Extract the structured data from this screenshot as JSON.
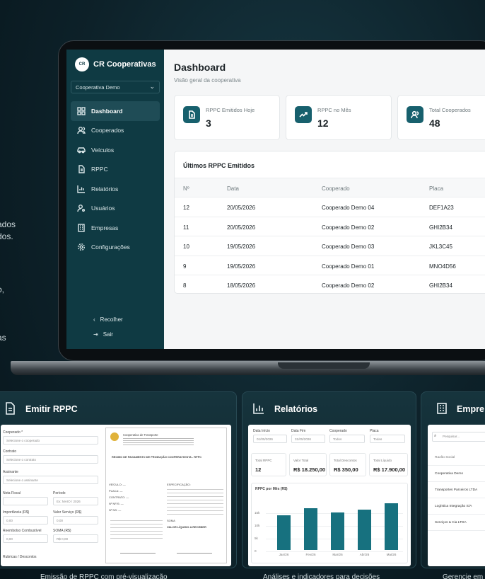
{
  "left_text": [
    "ados",
    "dos.",
    "o,",
    "as"
  ],
  "app": {
    "brand": "CR Cooperativas",
    "logo_text": "CR",
    "coop_select": "Cooperativa Demo"
  },
  "sidebar": {
    "items": [
      {
        "label": "Dashboard",
        "icon": "dashboard-icon",
        "active": true
      },
      {
        "label": "Cooperados",
        "icon": "users-icon"
      },
      {
        "label": "Veículos",
        "icon": "car-icon"
      },
      {
        "label": "RPPC",
        "icon": "document-icon"
      },
      {
        "label": "Relatórios",
        "icon": "chart-icon"
      },
      {
        "label": "Usuários",
        "icon": "user-key-icon"
      },
      {
        "label": "Empresas",
        "icon": "building-icon"
      },
      {
        "label": "Configurações",
        "icon": "gear-icon"
      }
    ],
    "collapse": "Recolher",
    "logout": "Sair"
  },
  "dashboard": {
    "title": "Dashboard",
    "subtitle": "Visão geral da cooperativa",
    "cards": [
      {
        "label": "RPPC Emitidos Hoje",
        "value": "3"
      },
      {
        "label": "RPPC no Mês",
        "value": "12"
      },
      {
        "label": "Total Cooperados",
        "value": "48"
      }
    ],
    "table": {
      "title": "Últimos RPPC Emitidos",
      "headers": [
        "Nº",
        "Data",
        "Cooperado",
        "Placa"
      ],
      "rows": [
        [
          "12",
          "20/05/2026",
          "Cooperado Demo 04",
          "DEF1A23"
        ],
        [
          "11",
          "20/05/2026",
          "Cooperado Demo 02",
          "GHI2B34"
        ],
        [
          "10",
          "19/05/2026",
          "Cooperado Demo 03",
          "JKL3C45"
        ],
        [
          "9",
          "19/05/2026",
          "Cooperado Demo 01",
          "MNO4D56"
        ],
        [
          "8",
          "18/05/2026",
          "Cooperado Demo 02",
          "GHI2B34"
        ]
      ]
    }
  },
  "panels": {
    "emitir": {
      "title": "Emitir RPPC",
      "caption": "Emissão de RPPC com pré-visualização",
      "form": {
        "cooperado_label": "Cooperado *",
        "cooperado_ph": "Selecione o cooperado",
        "contrato_label": "Contrato",
        "contrato_ph": "Selecione o contrato",
        "assinante_label": "Assinante",
        "assinante_ph": "Selecione o assinante",
        "nf_label": "Nota Fiscal",
        "periodo_label": "Período",
        "periodo_ph": "Ex: MAIO / 2026",
        "imp_label": "Importância (R$)",
        "imp_val": "0,00",
        "vs_label": "Valor Serviço (R$)",
        "vs_val": "0,00",
        "reemb_label": "Reembolso Combustível",
        "reemb_val": "0,00",
        "soma_label": "SOMA (R$)",
        "soma_val": "R$ 0,00",
        "rubricas": "Rubricas / Descontos"
      },
      "preview": {
        "header": "Cooperativa de Transporte",
        "title": "RECIBO DE PAGAMENTO DE PRODUÇÃO COOPERATIVISTA - RPPC",
        "veiculo": "VEÍCULO: —",
        "placa": "PLACA: —",
        "contrato": "CONTRATO: —",
        "nf": "Nº NF/S: —",
        "nota": "Nº NS: —",
        "espec": "ESPECIFICAÇÃO:",
        "soma": "SOMA",
        "liquido": "VALOR LÍQUIDO A RECEBER"
      }
    },
    "relatorios": {
      "title": "Relatórios",
      "caption": "Análises e indicadores para decisões",
      "filters": [
        {
          "label": "Data Início",
          "value": "01/05/2026"
        },
        {
          "label": "Data Fim",
          "value": "31/05/2026"
        },
        {
          "label": "Cooperado",
          "value": "Todos"
        },
        {
          "label": "Placa",
          "value": "Todas"
        }
      ],
      "kpis": [
        {
          "label": "Total RPPC",
          "value": "12"
        },
        {
          "label": "Valor Total",
          "value": "R$ 18.250,00"
        },
        {
          "label": "Total Descontos",
          "value": "R$ 350,00"
        },
        {
          "label": "Total Líquido",
          "value": "R$ 17.900,00"
        }
      ],
      "chart_title": "RPPC por Mês (R$)"
    },
    "empresas": {
      "title": "Empre",
      "caption": "Gerencie em",
      "search_ph": "Pesquisar...",
      "header": "Razão Social",
      "rows": [
        "Cooperativa Demo",
        "Transportes Parceiros LTDA",
        "Logística Integração S/A",
        "Serviços & Cia LTDA"
      ]
    }
  },
  "chart_data": {
    "type": "bar",
    "title": "RPPC por Mês (R$)",
    "categories": [
      "Jan/26",
      "Fev/26",
      "Mar/26",
      "Abr/26",
      "Mai/26"
    ],
    "values": [
      13500,
      16300,
      14600,
      15800,
      18200
    ],
    "ylim": [
      0,
      20000
    ],
    "yticks": [
      "0",
      "5k",
      "10k",
      "15k"
    ],
    "colors": {
      "bar": "#17717f"
    }
  }
}
